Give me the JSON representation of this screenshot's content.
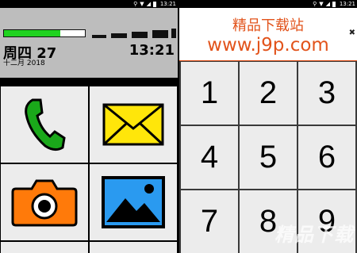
{
  "status_bar": {
    "time_left": "13:21",
    "time_right": "13:21"
  },
  "left_screen": {
    "battery_level": 0.7,
    "date_main": "周四 27",
    "date_sub": "十二月 2018",
    "clock": "13:21",
    "tiles": [
      {
        "name": "phone",
        "icon": "phone-icon",
        "color": "#1aa81a"
      },
      {
        "name": "messages",
        "icon": "envelope-icon",
        "color": "#ffe60a"
      },
      {
        "name": "camera",
        "icon": "camera-icon",
        "color": "#ff7a0a"
      },
      {
        "name": "gallery",
        "icon": "picture-icon",
        "color": "#2a9af0"
      }
    ]
  },
  "right_screen": {
    "ad": {
      "title": "精品下载站",
      "url": "www.j9p.com",
      "close": "✖"
    },
    "keys": [
      "1",
      "2",
      "3",
      "4",
      "5",
      "6",
      "7",
      "8",
      "9"
    ],
    "watermark": "精品下载"
  },
  "colors": {
    "accent": "#e2531b",
    "battery": "#1fd31f"
  }
}
